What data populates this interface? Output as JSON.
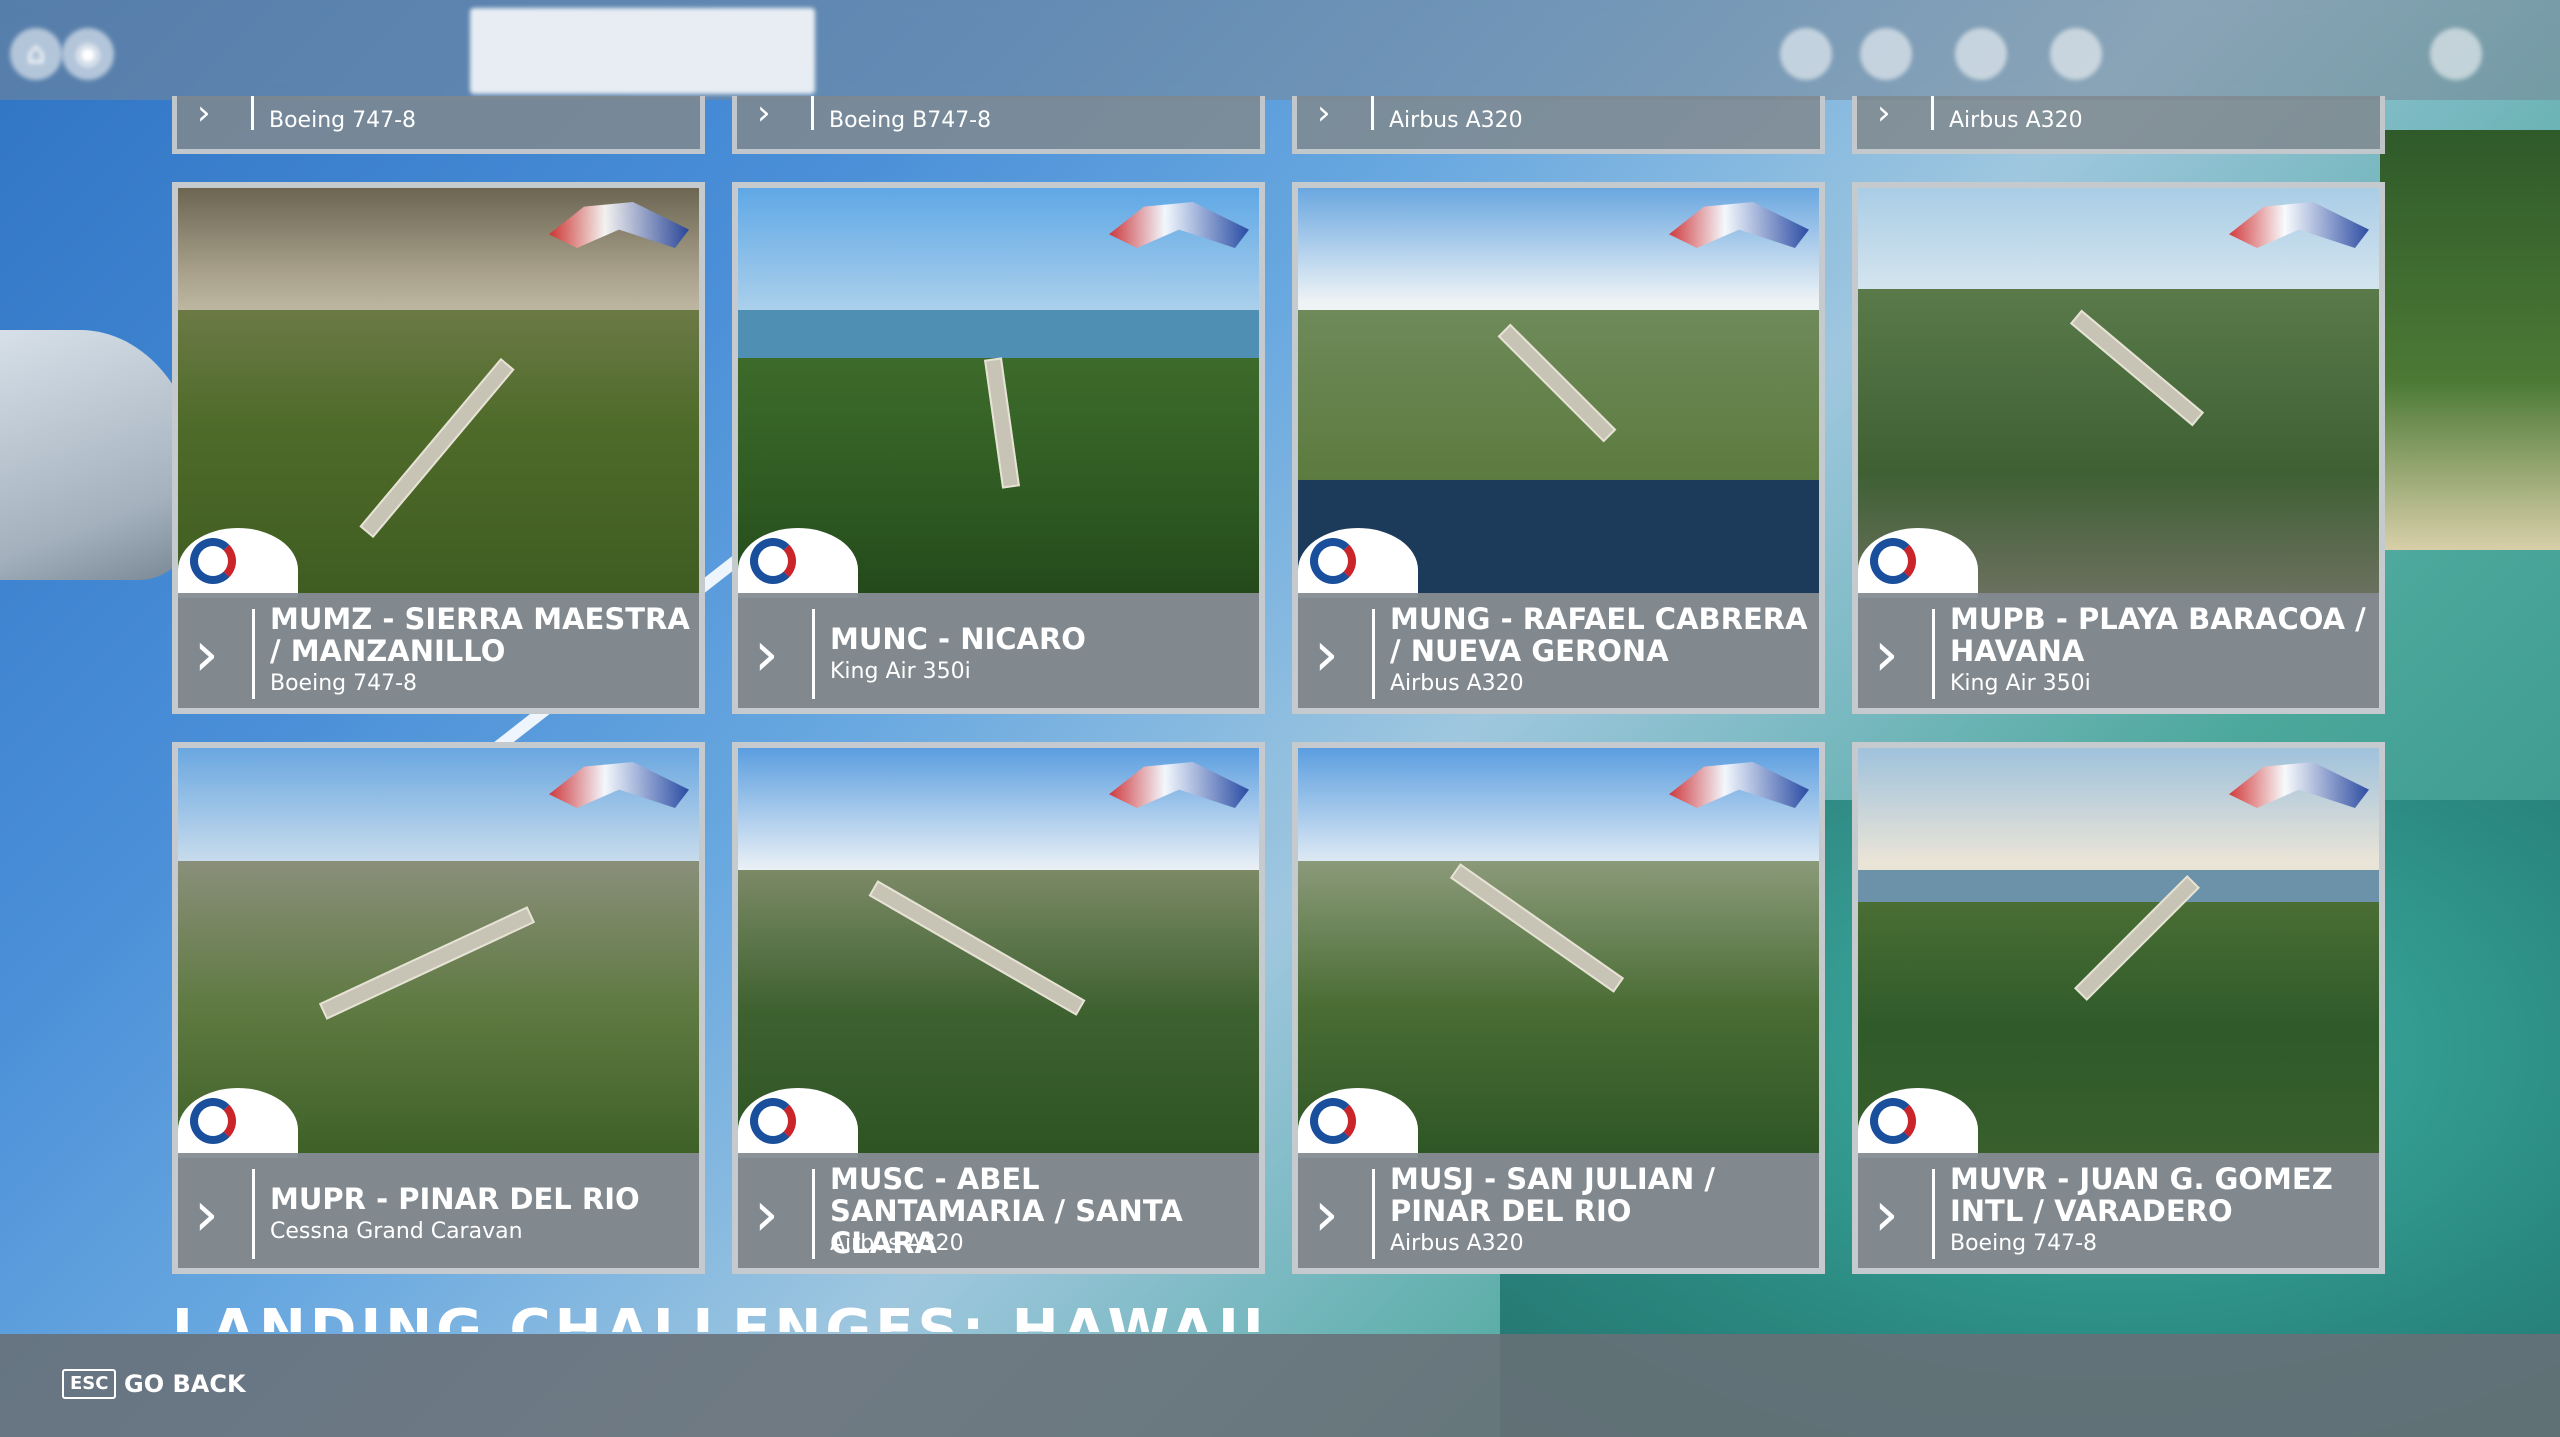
{
  "top_row_partial": [
    {
      "aircraft": "Boeing 747-8"
    },
    {
      "aircraft": "Boeing B747-8"
    },
    {
      "aircraft": "Airbus A320"
    },
    {
      "aircraft": "Airbus A320"
    }
  ],
  "cards": [
    {
      "title": "MUMZ - SIERRA MAESTRA / MANZANILLO",
      "aircraft": "Boeing 747-8"
    },
    {
      "title": "MUNC - NICARO",
      "aircraft": "King Air 350i"
    },
    {
      "title": "MUNG - RAFAEL CABRERA / NUEVA GERONA",
      "aircraft": "Airbus A320"
    },
    {
      "title": "MUPB - PLAYA BARACOA / HAVANA",
      "aircraft": "King Air 350i"
    },
    {
      "title": "MUPR - PINAR DEL RIO",
      "aircraft": "Cessna Grand Caravan"
    },
    {
      "title": "MUSC - ABEL SANTAMARIA / SANTA CLARA",
      "aircraft": "Airbus A320"
    },
    {
      "title": "MUSJ - SAN JULIAN / PINAR DEL RIO",
      "aircraft": "Airbus A320"
    },
    {
      "title": "MUVR - JUAN G. GOMEZ INTL / VARADERO",
      "aircraft": "Boeing 747-8"
    }
  ],
  "section_heading": "LANDING CHALLENGES: HAWAII",
  "footer": {
    "esc_key": "ESC",
    "go_back": "GO BACK"
  },
  "icons": {
    "chevron": "chevron-right-icon",
    "logo": "landing-challenge-flag-logo",
    "badge": "game-logo-badge"
  }
}
